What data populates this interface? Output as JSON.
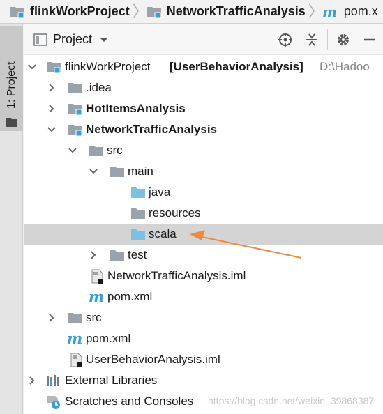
{
  "breadcrumb": {
    "items": [
      {
        "label": "flinkWorkProject"
      },
      {
        "label": "NetworkTrafficAnalysis"
      },
      {
        "label": "pom.x"
      }
    ]
  },
  "tool_window_tab": {
    "label": "1: Project"
  },
  "panel": {
    "title": "Project"
  },
  "tree": {
    "root": {
      "label": "flinkWorkProject",
      "bracket": "[UserBehaviorAnalysis]",
      "path_hint": "D:\\Hadoo"
    },
    "idea": {
      "label": ".idea"
    },
    "hot_items": {
      "label": "HotItemsAnalysis"
    },
    "network": {
      "label": "NetworkTrafficAnalysis"
    },
    "src1": {
      "label": "src"
    },
    "main": {
      "label": "main"
    },
    "java": {
      "label": "java"
    },
    "resources": {
      "label": "resources"
    },
    "scala": {
      "label": "scala"
    },
    "test": {
      "label": "test"
    },
    "network_iml": {
      "label": "NetworkTrafficAnalysis.iml"
    },
    "network_pom": {
      "label": "pom.xml"
    },
    "src2": {
      "label": "src"
    },
    "root_pom": {
      "label": "pom.xml"
    },
    "root_iml": {
      "label": "UserBehaviorAnalysis.iml"
    },
    "ext_libs": {
      "label": "External Libraries"
    },
    "scratches": {
      "label": "Scratches and Consoles"
    }
  },
  "watermark": {
    "text": "https://blog.csdn.net/weixin_39868387"
  },
  "colors": {
    "accent_arrow": "#f08a3c",
    "folder_gray": "#9aa3ab",
    "folder_blue": "#7cc0e4",
    "module_badge": "#3a9fd6",
    "selection": "#d4d4d4"
  }
}
